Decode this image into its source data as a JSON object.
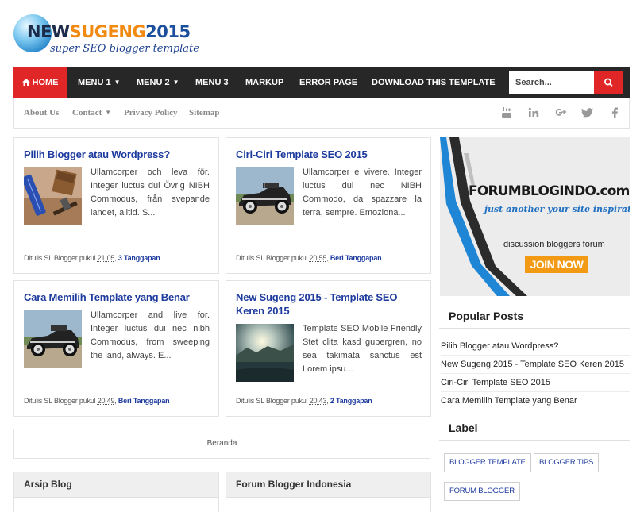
{
  "brand": {
    "title_part1": "NEW",
    "title_part2": "SUGENG",
    "title_part3": "2015",
    "tagline": "super SEO blogger template"
  },
  "mainnav": {
    "home": "HOME",
    "items": [
      "MENU 1",
      "MENU 2",
      "MENU 3",
      "MARKUP",
      "ERROR PAGE",
      "DOWNLOAD THIS TEMPLATE"
    ],
    "search_placeholder": "Search..."
  },
  "subnav": {
    "items": [
      "About Us",
      "Contact",
      "Privacy Policy",
      "Sitemap"
    ],
    "social_icons": [
      "youtube-icon",
      "linkedin-icon",
      "google-plus-icon",
      "twitter-icon",
      "facebook-icon"
    ]
  },
  "posts": [
    {
      "title": "Pilih Blogger atau Wordpress?",
      "excerpt": "Ullamcorper och leva för. Integer luctus dui Övrig NIBH Commodus, från svepande landet, alltid. S...",
      "by": "Ditulis SL Blogger pukul",
      "time": "21.05",
      "comments": "3 Tanggapan"
    },
    {
      "title": "Ciri-Ciri Template SEO 2015",
      "excerpt": "Ullamcorper e vivere. Integer luctus dui nec NIBH Commodo, da spazzare la terra, sempre. Emoziona...",
      "by": "Ditulis SL Blogger pukul",
      "time": "20.55",
      "comments": "Beri Tanggapan"
    },
    {
      "title": "Cara Memilih Template yang Benar",
      "excerpt": "Ullamcorper and live for. Integer luctus dui nec nibh Commodus, from sweeping the land, always. E...",
      "by": "Ditulis SL Blogger pukul",
      "time": "20.49",
      "comments": "Beri Tanggapan"
    },
    {
      "title": "New Sugeng 2015 - Template SEO Keren 2015",
      "excerpt": "Template SEO Mobile Friendly Stet clita kasd gubergren, no sea takimata sanctus est Lorem ipsu...",
      "by": "Ditulis SL Blogger pukul",
      "time": "20.43",
      "comments": "2 Tanggapan"
    }
  ],
  "pager": {
    "home": "Beranda"
  },
  "widgets": {
    "archive": "Arsip Blog",
    "forum": "Forum Blogger Indonesia"
  },
  "banner": {
    "brand": "FORUMBLOGINDO.com",
    "tagline": "just another your site inspirations",
    "caption": "discussion bloggers forum",
    "cta": "JOIN NOW"
  },
  "sidebar": {
    "popular_title": "Popular Posts",
    "popular": [
      "Pilih Blogger atau Wordpress?",
      "New Sugeng 2015 - Template SEO Keren 2015",
      "Ciri-Ciri Template SEO 2015",
      "Cara Memilih Template yang Benar"
    ],
    "label_title": "Label",
    "labels": [
      "BLOGGER TEMPLATE",
      "BLOGGER TIPS",
      "FORUM BLOGGER"
    ]
  },
  "colors": {
    "accent": "#e02626",
    "nav": "#272727",
    "link": "#1d3a9e"
  }
}
